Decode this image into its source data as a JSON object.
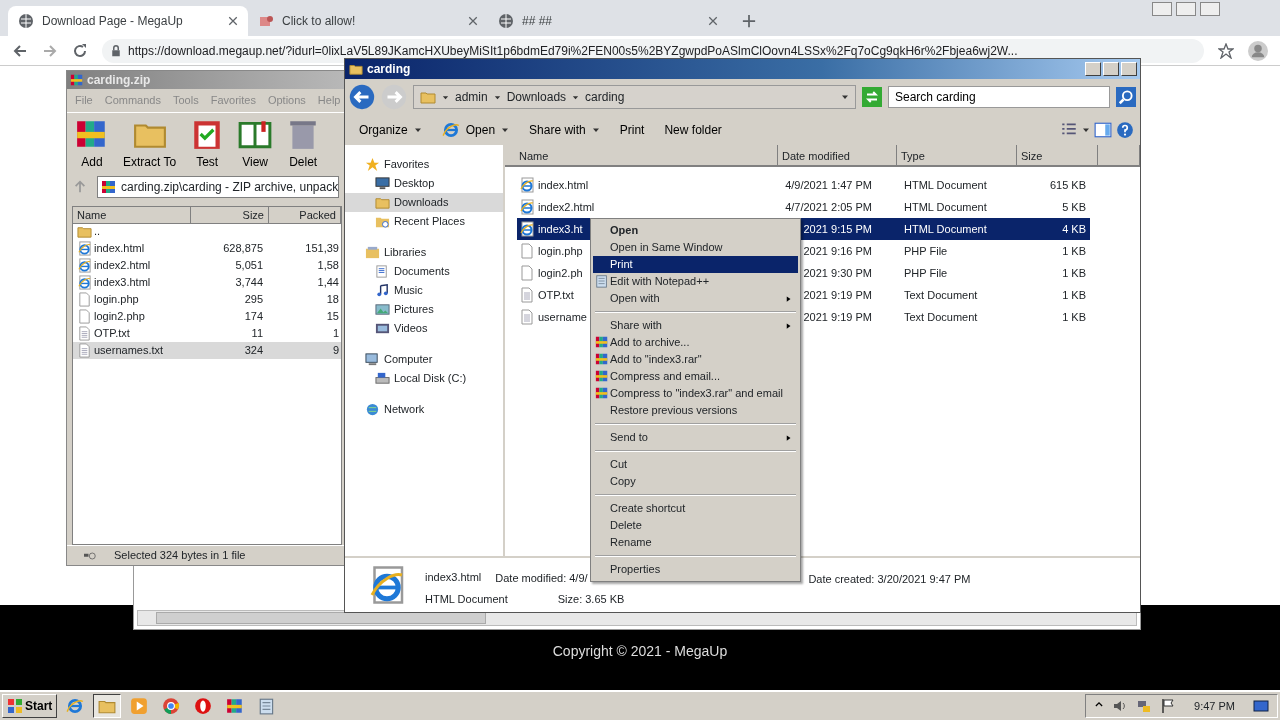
{
  "browser": {
    "tabs": [
      {
        "title": "Download Page - MegaUp",
        "selected": true
      },
      {
        "title": "Click to allow!",
        "selected": false
      },
      {
        "title": "## ##",
        "selected": false
      }
    ],
    "url": "https://download.megaup.net/?idurl=0lixLaV5L89JKamcHXUbeyMiSIt1p6bdmEd79i%2FEN00s5%2BYZgwpdPoASlmClOovn4LSSx%2Fq7oCg9qkH6r%2Fbjea6wj2W...",
    "footer": "Copyright © 2021 - MegaUp"
  },
  "winrar": {
    "title": "carding.zip",
    "menu": [
      "File",
      "Commands",
      "Tools",
      "Favorites",
      "Options",
      "Help"
    ],
    "toolbar": [
      "Add",
      "Extract To",
      "Test",
      "View",
      "Delet"
    ],
    "address": "carding.zip\\carding - ZIP archive, unpack",
    "columns": [
      "Name",
      "Size",
      "Packed"
    ],
    "rows": [
      {
        "name": "..",
        "kind": "folder",
        "selected": false
      },
      {
        "name": "index.html",
        "size": "628,875",
        "packed": "151,39",
        "kind": "html",
        "selected": false
      },
      {
        "name": "index2.html",
        "size": "5,051",
        "packed": "1,58",
        "kind": "html",
        "selected": false
      },
      {
        "name": "index3.html",
        "size": "3,744",
        "packed": "1,44",
        "kind": "html",
        "selected": false
      },
      {
        "name": "login.php",
        "size": "295",
        "packed": "18",
        "kind": "php",
        "selected": false
      },
      {
        "name": "login2.php",
        "size": "174",
        "packed": "15",
        "kind": "php",
        "selected": false
      },
      {
        "name": "OTP.txt",
        "size": "11",
        "packed": "1",
        "kind": "text",
        "selected": false
      },
      {
        "name": "usernames.txt",
        "size": "324",
        "packed": "9",
        "kind": "text",
        "selected": true
      }
    ],
    "status": "Selected 324 bytes in 1 file"
  },
  "explorer": {
    "title": "carding",
    "breadcrumb": [
      "admin",
      "Downloads",
      "carding"
    ],
    "search": {
      "placeholder": "Search carding"
    },
    "toolbar": [
      {
        "label": "Organize",
        "dropdown": true
      },
      {
        "label": "Open",
        "dropdown": true
      },
      {
        "label": "Share with",
        "dropdown": true
      },
      {
        "label": "Print",
        "dropdown": false
      },
      {
        "label": "New folder",
        "dropdown": false
      }
    ],
    "sidebar": [
      {
        "label": "Favorites",
        "selected": false,
        "children": [
          {
            "label": "Desktop",
            "selected": false
          },
          {
            "label": "Downloads",
            "selected": true
          },
          {
            "label": "Recent Places",
            "selected": false
          }
        ]
      },
      {
        "label": "Libraries",
        "selected": false,
        "children": [
          {
            "label": "Documents",
            "selected": false
          },
          {
            "label": "Music",
            "selected": false
          },
          {
            "label": "Pictures",
            "selected": false
          },
          {
            "label": "Videos",
            "selected": false
          }
        ]
      },
      {
        "label": "Computer",
        "selected": false,
        "children": [
          {
            "label": "Local Disk (C:)",
            "selected": false
          }
        ]
      },
      {
        "label": "Network",
        "selected": false
      }
    ],
    "columns": [
      "Name",
      "Date modified",
      "Type",
      "Size"
    ],
    "files": [
      {
        "name": "index.html",
        "date": "4/9/2021 1:47 PM",
        "type": "HTML Document",
        "size": "615 KB",
        "kind": "html",
        "selected": false
      },
      {
        "name": "index2.html",
        "date": "4/7/2021 2:05 PM",
        "type": "HTML Document",
        "size": "5 KB",
        "kind": "html",
        "selected": false
      },
      {
        "name": "index3.ht",
        "date": "2021 9:15 PM",
        "type": "HTML Document",
        "size": "4 KB",
        "kind": "html",
        "selected": true
      },
      {
        "name": "login.php",
        "date": "2021 9:16 PM",
        "type": "PHP File",
        "size": "1 KB",
        "kind": "php",
        "selected": false
      },
      {
        "name": "login2.ph",
        "date": "2021 9:30 PM",
        "type": "PHP File",
        "size": "1 KB",
        "kind": "php",
        "selected": false
      },
      {
        "name": "OTP.txt",
        "date": "2021 9:19 PM",
        "type": "Text Document",
        "size": "1 KB",
        "kind": "text",
        "selected": false
      },
      {
        "name": "username",
        "date": "2021 9:19 PM",
        "type": "Text Document",
        "size": "1 KB",
        "kind": "text",
        "selected": false
      }
    ],
    "details": {
      "name": "index3.html",
      "type": "HTML Document",
      "modified": "Date modified: 4/9/",
      "size": "Size: 3.65 KB",
      "created": "Date created: 3/20/2021 9:47 PM"
    }
  },
  "context_menu": [
    {
      "kind": "item",
      "label": "Open",
      "bold": true,
      "selected": false
    },
    {
      "kind": "item",
      "label": "Open in Same Window",
      "bold": false,
      "selected": false
    },
    {
      "kind": "item",
      "label": "Print",
      "bold": false,
      "selected": true
    },
    {
      "kind": "notepad",
      "label": "Edit with Notepad++",
      "bold": false,
      "selected": false
    },
    {
      "kind": "submenu",
      "label": "Open with",
      "bold": false,
      "selected": false
    },
    {
      "kind": "separator"
    },
    {
      "kind": "submenu",
      "label": "Share with",
      "bold": false,
      "selected": false
    },
    {
      "kind": "archive",
      "label": "Add to archive...",
      "bold": false,
      "selected": false
    },
    {
      "kind": "archive",
      "label": "Add to \"index3.rar\"",
      "bold": false,
      "selected": false
    },
    {
      "kind": "archive",
      "label": "Compress and email...",
      "bold": false,
      "selected": false
    },
    {
      "kind": "archive",
      "label": "Compress to \"index3.rar\" and email",
      "bold": false,
      "selected": false
    },
    {
      "kind": "item",
      "label": "Restore previous versions",
      "bold": false,
      "selected": false
    },
    {
      "kind": "separator"
    },
    {
      "kind": "submenu",
      "label": "Send to",
      "bold": false,
      "selected": false
    },
    {
      "kind": "separator"
    },
    {
      "kind": "item",
      "label": "Cut",
      "bold": false,
      "selected": false
    },
    {
      "kind": "item",
      "label": "Copy",
      "bold": false,
      "selected": false
    },
    {
      "kind": "separator"
    },
    {
      "kind": "item",
      "label": "Create shortcut",
      "bold": false,
      "selected": false
    },
    {
      "kind": "item",
      "label": "Delete",
      "bold": false,
      "selected": false
    },
    {
      "kind": "item",
      "label": "Rename",
      "bold": false,
      "selected": false
    },
    {
      "kind": "separator"
    },
    {
      "kind": "item",
      "label": "Properties",
      "bold": false,
      "selected": false
    }
  ],
  "taskbar": {
    "start": "Start",
    "apps": [
      {
        "selected": false
      },
      {
        "selected": true
      },
      {
        "selected": false
      },
      {
        "selected": false
      },
      {
        "selected": false
      },
      {
        "selected": false
      },
      {
        "selected": false
      }
    ],
    "clock": "9:47 PM"
  }
}
